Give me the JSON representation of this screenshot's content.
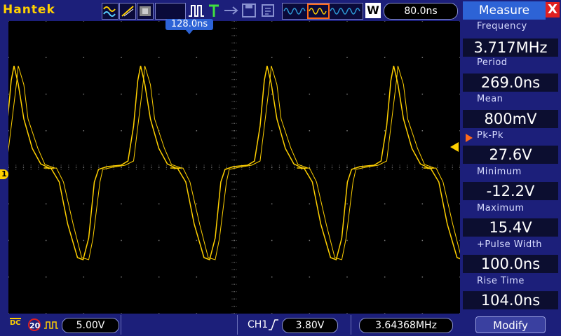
{
  "brand": "Hantek",
  "toolbar": {
    "icons": [
      "waveform-type-icon",
      "xy-mode-icon",
      "persistence-icon",
      "pulse-icon",
      "trigger-icon",
      "cursor-icon",
      "save-icon",
      "settings-icon"
    ],
    "timebase": "80.0ns",
    "window_label": "W"
  },
  "screen": {
    "trigger_position": "128.0ns",
    "channel_marker": "1"
  },
  "bottom": {
    "coupling": "DC",
    "bw_limit": "20",
    "ch1_scale": "5.00V",
    "trigger_source": "CH1",
    "trigger_level": "3.80V",
    "trigger_frequency": "3.64368MHz"
  },
  "measure": {
    "title": "Measure",
    "close": "X",
    "items": [
      {
        "label": "Frequency",
        "value": "3.717MHz"
      },
      {
        "label": "Period",
        "value": "269.0ns"
      },
      {
        "label": "Mean",
        "value": "800mV"
      },
      {
        "label": "Pk-Pk",
        "value": "27.6V"
      },
      {
        "label": "Minimum",
        "value": "-12.2V"
      },
      {
        "label": "Maximum",
        "value": "15.4V"
      },
      {
        "label": "+Pulse Width",
        "value": "100.0ns"
      },
      {
        "label": "Rise Time",
        "value": "104.0ns"
      }
    ],
    "modify_label": "Modify"
  },
  "colors": {
    "background": "#1c1f7a",
    "trace": "#ffd000",
    "accent": "#2d63d6",
    "close": "#e02020"
  }
}
